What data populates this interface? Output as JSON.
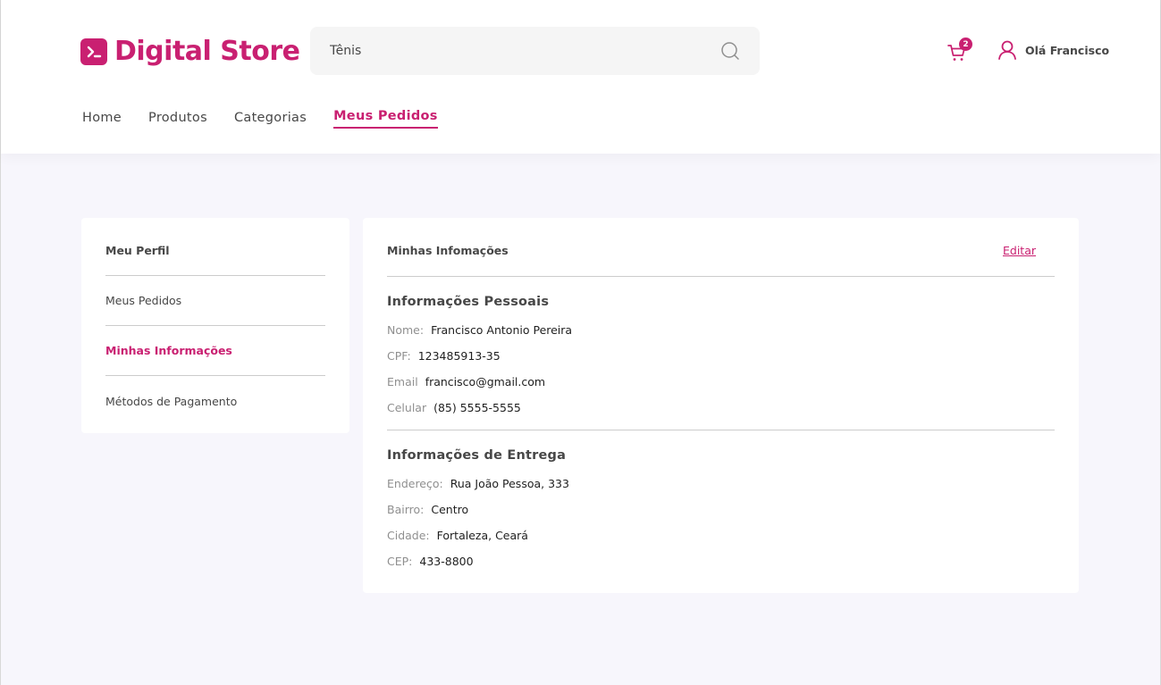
{
  "brand": {
    "name": "Digital Store",
    "color": "#C92071"
  },
  "search": {
    "value": "Tênis",
    "icon": "search-icon"
  },
  "cart": {
    "count": "2",
    "icon": "cart-icon"
  },
  "user": {
    "greeting": "Olá Francisco",
    "icon": "user-icon"
  },
  "nav": {
    "items": [
      {
        "label": "Home",
        "active": false
      },
      {
        "label": "Produtos",
        "active": false
      },
      {
        "label": "Categorias",
        "active": false
      },
      {
        "label": "Meus Pedidos",
        "active": true
      }
    ]
  },
  "sidebar": {
    "title": "Meu Perfil",
    "items": [
      {
        "label": "Meus Pedidos",
        "active": false
      },
      {
        "label": "Minhas Informações",
        "active": true
      },
      {
        "label": "Métodos de Pagamento",
        "active": false
      }
    ]
  },
  "info": {
    "title": "Minhas Infomações",
    "edit_label": "Editar",
    "personal": {
      "title": "Informações Pessoais",
      "fields": [
        {
          "label": "Nome:",
          "value": "Francisco Antonio Pereira"
        },
        {
          "label": "CPF:",
          "value": "123485913-35"
        },
        {
          "label": "Email",
          "value": "francisco@gmail.com"
        },
        {
          "label": "Celular",
          "value": "(85) 5555-5555"
        }
      ]
    },
    "delivery": {
      "title": "Informações de Entrega",
      "fields": [
        {
          "label": "Endereço:",
          "value": "Rua João Pessoa, 333"
        },
        {
          "label": "Bairro:",
          "value": "Centro"
        },
        {
          "label": "Cidade:",
          "value": "Fortaleza, Ceará"
        },
        {
          "label": "CEP:",
          "value": "433-8800"
        }
      ]
    }
  }
}
